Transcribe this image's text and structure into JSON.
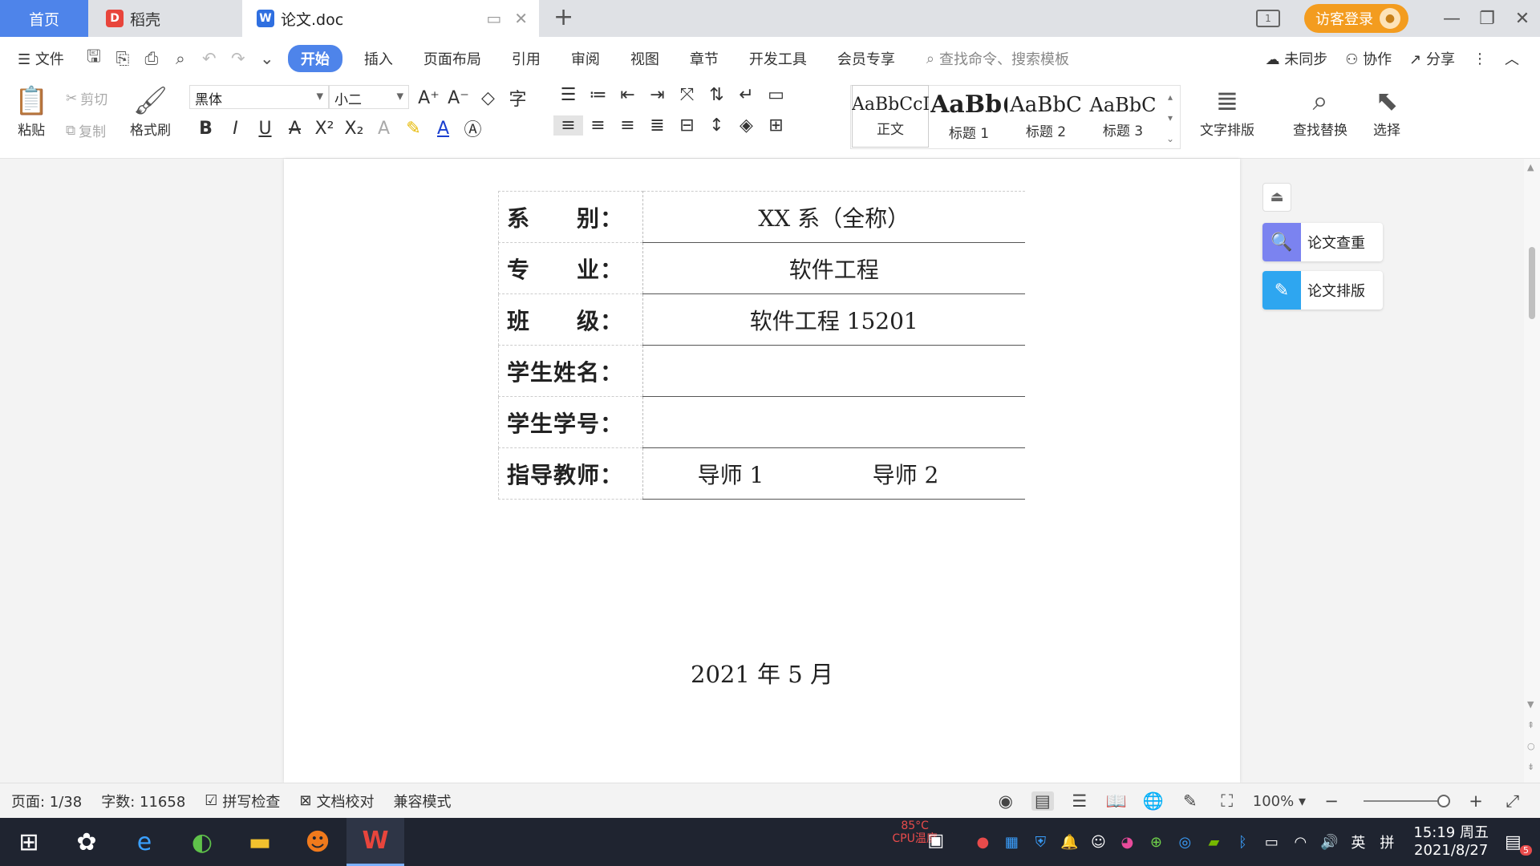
{
  "tabs": {
    "home": "首页",
    "daoke": "稻壳",
    "doc": "论文.doc"
  },
  "window": {
    "login": "访客登录"
  },
  "menu": {
    "file": "文件",
    "items": [
      "开始",
      "插入",
      "页面布局",
      "引用",
      "审阅",
      "视图",
      "章节",
      "开发工具",
      "会员专享"
    ],
    "search_placeholder": "查找命令、搜索模板",
    "sync": "未同步",
    "collab": "协作",
    "share": "分享"
  },
  "ribbon": {
    "paste": "粘贴",
    "cut": "剪切",
    "copy": "复制",
    "format_painter": "格式刷",
    "font_name": "黑体",
    "font_size": "小二",
    "styles": [
      {
        "sample": "AaBbCcI",
        "name": "正文"
      },
      {
        "sample": "AaBb(",
        "name": "标题 1"
      },
      {
        "sample": "AaBbC",
        "name": "标题 2"
      },
      {
        "sample": "AaBbC",
        "name": "标题 3"
      }
    ],
    "text_layout": "文字排版",
    "find_replace": "查找替换",
    "select": "选择"
  },
  "document": {
    "rows": [
      {
        "label": "系　　别：",
        "value": "XX 系（全称）"
      },
      {
        "label": "专　　业：",
        "value": "软件工程"
      },
      {
        "label": "班　　级：",
        "value": "软件工程 15201"
      },
      {
        "label": "学生姓名：",
        "value": ""
      },
      {
        "label": "学生学号：",
        "value": ""
      }
    ],
    "advisor_label": "指导教师：",
    "advisor1": "导师 1",
    "advisor2": "导师 2",
    "date": "2021 年 5 月"
  },
  "side_panel": {
    "check": "论文查重",
    "layout": "论文排版"
  },
  "status": {
    "page": "页面: 1/38",
    "words": "字数: 11658",
    "spell": "拼写检查",
    "proof": "文档校对",
    "compat": "兼容模式",
    "zoom": "100%"
  },
  "taskbar": {
    "cpu_temp": "85°C",
    "cpu_label": "CPU温度",
    "ime": "英",
    "ime2": "拼",
    "time": "15:19 周五",
    "date": "2021/8/27",
    "notif_count": "5"
  },
  "colors": {
    "accent": "#4e84ea",
    "login": "#f39c1f"
  }
}
